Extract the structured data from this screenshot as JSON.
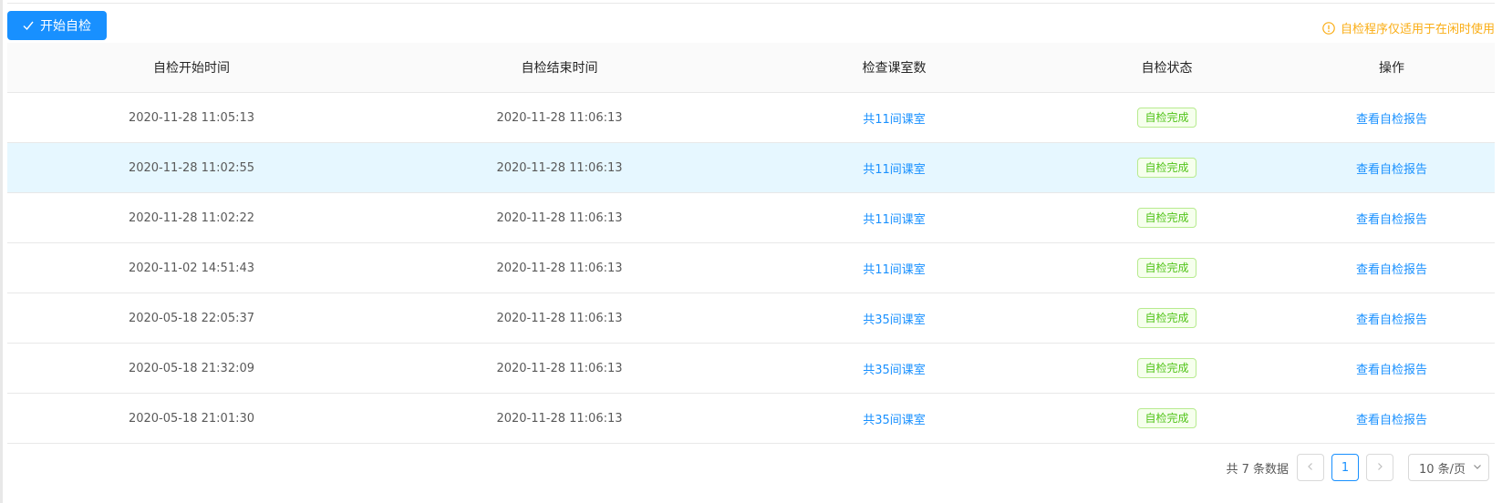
{
  "toolbar": {
    "start_label": "开始自检",
    "notice_text": "自检程序仅适用于在闲时使用"
  },
  "table": {
    "columns": [
      "自检开始时间",
      "自检结束时间",
      "检查课室数",
      "自检状态",
      "操作"
    ],
    "rows": [
      {
        "start": "2020-11-28 11:05:13",
        "end": "2020-11-28 11:06:13",
        "rooms": "共11间课室",
        "status": "自检完成",
        "action": "查看自检报告"
      },
      {
        "start": "2020-11-28 11:02:55",
        "end": "2020-11-28 11:06:13",
        "rooms": "共11间课室",
        "status": "自检完成",
        "action": "查看自检报告"
      },
      {
        "start": "2020-11-28 11:02:22",
        "end": "2020-11-28 11:06:13",
        "rooms": "共11间课室",
        "status": "自检完成",
        "action": "查看自检报告"
      },
      {
        "start": "2020-11-02 14:51:43",
        "end": "2020-11-28 11:06:13",
        "rooms": "共11间课室",
        "status": "自检完成",
        "action": "查看自检报告"
      },
      {
        "start": "2020-05-18 22:05:37",
        "end": "2020-11-28 11:06:13",
        "rooms": "共35间课室",
        "status": "自检完成",
        "action": "查看自检报告"
      },
      {
        "start": "2020-05-18 21:32:09",
        "end": "2020-11-28 11:06:13",
        "rooms": "共35间课室",
        "status": "自检完成",
        "action": "查看自检报告"
      },
      {
        "start": "2020-05-18 21:01:30",
        "end": "2020-11-28 11:06:13",
        "rooms": "共35间课室",
        "status": "自检完成",
        "action": "查看自检报告"
      }
    ]
  },
  "pagination": {
    "total_text": "共 7 条数据",
    "current_page": "1",
    "page_size_label": "10 条/页"
  },
  "icons": {
    "start": "check-icon",
    "notice": "info-circle-icon",
    "prev": "chevron-left-icon",
    "next": "chevron-right-icon",
    "size": "chevron-down-icon"
  },
  "colors": {
    "primary": "#1890ff",
    "warning": "#faad14",
    "success": "#52c41a",
    "row_hover": "#e6f7ff"
  }
}
